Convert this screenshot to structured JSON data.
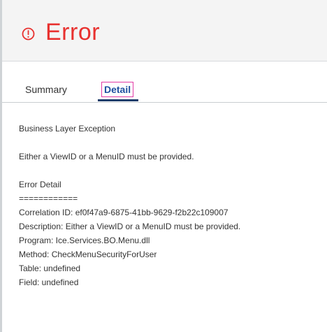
{
  "header": {
    "icon": "error-circle-icon",
    "title": "Error",
    "accent_color": "#e8312f"
  },
  "tabs": [
    {
      "label": "Summary",
      "active": false
    },
    {
      "label": "Detail",
      "active": true
    }
  ],
  "detail": {
    "exception": "Business Layer Exception",
    "message": "Either a ViewID or a MenuID must be provided.",
    "section_title": "Error Detail",
    "separator": "============",
    "correlation_id": "Correlation ID: ef0f47a9-6875-41bb-9629-f2b22c109007",
    "description": "Description: Either a ViewID or a MenuID must be provided.",
    "program": "Program: Ice.Services.BO.Menu.dll",
    "method": "Method: CheckMenuSecurityForUser",
    "table": "Table: undefined",
    "field": "Field: undefined"
  }
}
